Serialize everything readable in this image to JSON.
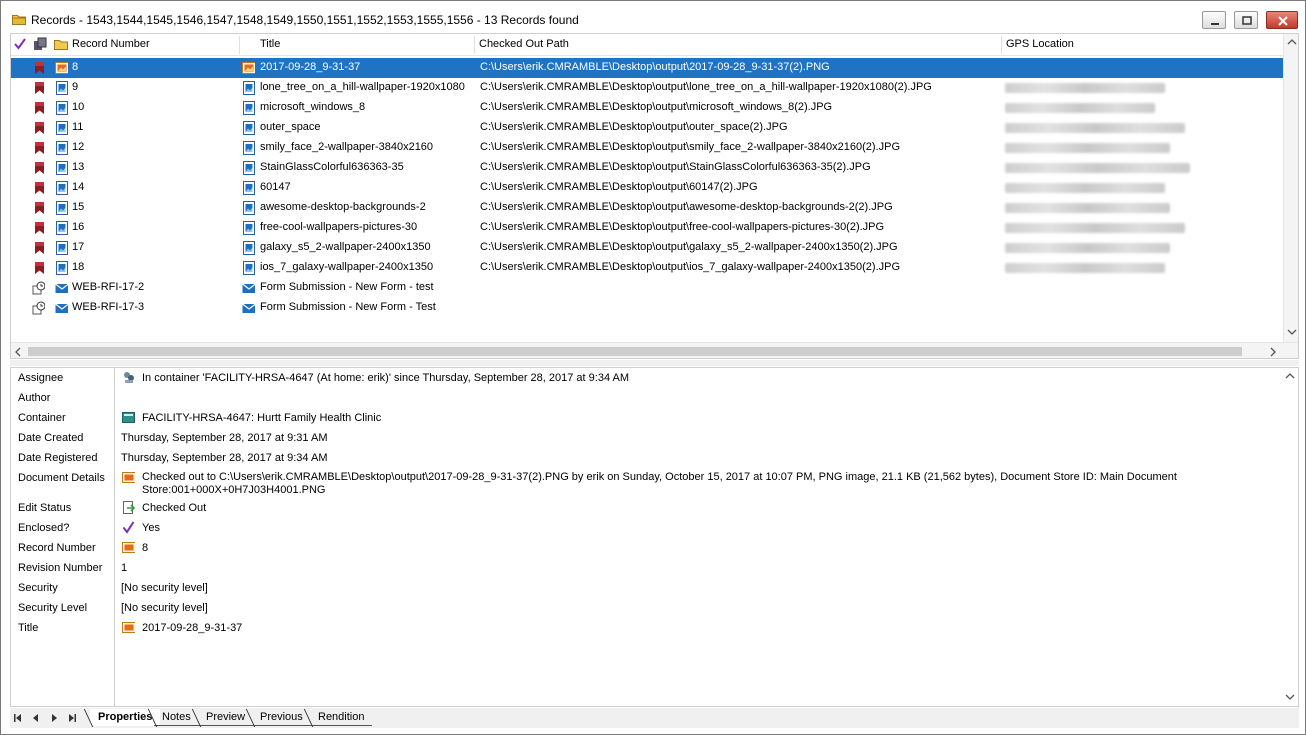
{
  "window": {
    "title": "Records - 1543,1544,1545,1546,1547,1548,1549,1550,1551,1552,1553,1555,1556 - 13 Records found"
  },
  "grid": {
    "columns": {
      "record_number": "Record Number",
      "title": "Title",
      "checked_out_path": "Checked Out Path",
      "gps_location": "GPS Location"
    },
    "rows": [
      {
        "num": "8",
        "title": "2017-09-28_9-31-37",
        "path": "C:\\Users\\erik.CMRAMBLE\\Desktop\\output\\2017-09-28_9-31-37(2).PNG",
        "kind": "png",
        "selected": true
      },
      {
        "num": "9",
        "title": "lone_tree_on_a_hill-wallpaper-1920x1080",
        "path": "C:\\Users\\erik.CMRAMBLE\\Desktop\\output\\lone_tree_on_a_hill-wallpaper-1920x1080(2).JPG",
        "kind": "jpg"
      },
      {
        "num": "10",
        "title": "microsoft_windows_8",
        "path": "C:\\Users\\erik.CMRAMBLE\\Desktop\\output\\microsoft_windows_8(2).JPG",
        "kind": "jpg"
      },
      {
        "num": "11",
        "title": "outer_space",
        "path": "C:\\Users\\erik.CMRAMBLE\\Desktop\\output\\outer_space(2).JPG",
        "kind": "jpg"
      },
      {
        "num": "12",
        "title": "smily_face_2-wallpaper-3840x2160",
        "path": "C:\\Users\\erik.CMRAMBLE\\Desktop\\output\\smily_face_2-wallpaper-3840x2160(2).JPG",
        "kind": "jpg"
      },
      {
        "num": "13",
        "title": "StainGlassColorful636363-35",
        "path": "C:\\Users\\erik.CMRAMBLE\\Desktop\\output\\StainGlassColorful636363-35(2).JPG",
        "kind": "jpg"
      },
      {
        "num": "14",
        "title": "60147",
        "path": "C:\\Users\\erik.CMRAMBLE\\Desktop\\output\\60147(2).JPG",
        "kind": "jpg"
      },
      {
        "num": "15",
        "title": "awesome-desktop-backgrounds-2",
        "path": "C:\\Users\\erik.CMRAMBLE\\Desktop\\output\\awesome-desktop-backgrounds-2(2).JPG",
        "kind": "jpg"
      },
      {
        "num": "16",
        "title": "free-cool-wallpapers-pictures-30",
        "path": "C:\\Users\\erik.CMRAMBLE\\Desktop\\output\\free-cool-wallpapers-pictures-30(2).JPG",
        "kind": "jpg"
      },
      {
        "num": "17",
        "title": "galaxy_s5_2-wallpaper-2400x1350",
        "path": "C:\\Users\\erik.CMRAMBLE\\Desktop\\output\\galaxy_s5_2-wallpaper-2400x1350(2).JPG",
        "kind": "jpg"
      },
      {
        "num": "18",
        "title": "ios_7_galaxy-wallpaper-2400x1350",
        "path": "C:\\Users\\erik.CMRAMBLE\\Desktop\\output\\ios_7_galaxy-wallpaper-2400x1350(2).JPG",
        "kind": "jpg"
      },
      {
        "num": "WEB-RFI-17-2",
        "title": "Form Submission - New Form - test",
        "path": "",
        "kind": "email"
      },
      {
        "num": "WEB-RFI-17-3",
        "title": "Form Submission - New Form - Test",
        "path": "",
        "kind": "email"
      }
    ]
  },
  "properties": [
    {
      "label": "Assignee",
      "value": "In container 'FACILITY-HRSA-4647 (At home: erik)'  since Thursday, September 28, 2017 at 9:34 AM",
      "icon": "location-icon"
    },
    {
      "label": "Author",
      "value": ""
    },
    {
      "label": "Container",
      "value": "FACILITY-HRSA-4647: Hurtt Family Health Clinic",
      "icon": "container-icon"
    },
    {
      "label": "Date Created",
      "value": "Thursday, September 28, 2017 at 9:31 AM"
    },
    {
      "label": "Date Registered",
      "value": "Thursday, September 28, 2017 at 9:34 AM"
    },
    {
      "label": "Document Details",
      "value": "Checked out to C:\\Users\\erik.CMRAMBLE\\Desktop\\output\\2017-09-28_9-31-37(2).PNG by erik on Sunday, October 15, 2017 at 10:07 PM, PNG image, 21.1 KB (21,562 bytes), Document Store ID: Main Document Store:001+000X+0H7J03H4001.PNG",
      "icon": "png-icon",
      "wrap": true
    },
    {
      "label": "Edit Status",
      "value": "Checked Out",
      "icon": "checked-out-icon"
    },
    {
      "label": "Enclosed?",
      "value": "Yes",
      "icon": "checkmark-icon"
    },
    {
      "label": "Record Number",
      "value": "8",
      "icon": "png-icon"
    },
    {
      "label": "Revision Number",
      "value": "1"
    },
    {
      "label": "Security",
      "value": "[No security level]"
    },
    {
      "label": "Security Level",
      "value": "[No security level]"
    },
    {
      "label": "Title",
      "value": "2017-09-28_9-31-37",
      "icon": "png-icon"
    }
  ],
  "tabs": [
    "Properties",
    "Notes",
    "Preview",
    "Previous",
    "Rendition"
  ],
  "colors": {
    "selection": "#1e73c4",
    "enclosed_check": "#7b2fbe",
    "record_red": "#a3212a",
    "image_blue": "#1d6fc2"
  }
}
